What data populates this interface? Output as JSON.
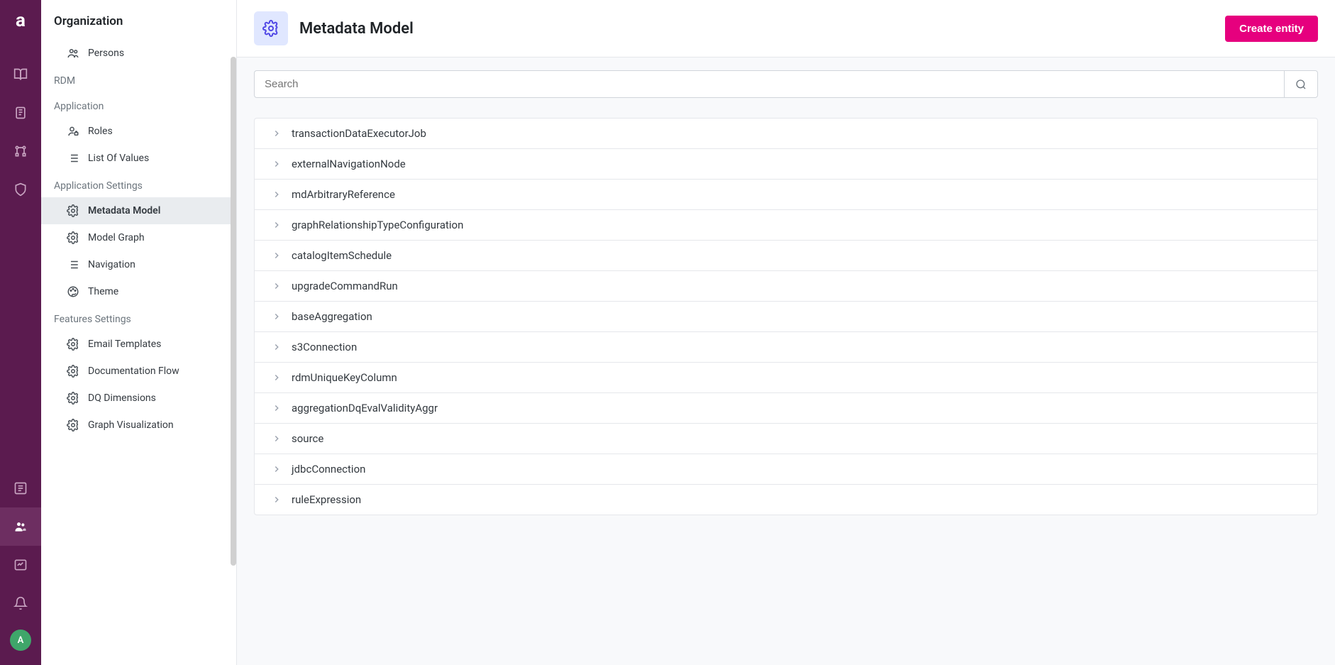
{
  "rail": {
    "logo": "a",
    "avatar": "A"
  },
  "sidebar": {
    "title": "Organization",
    "groups": [
      {
        "label": null,
        "items": [
          {
            "icon": "users",
            "label": "Persons",
            "active": false
          }
        ]
      },
      {
        "label": "RDM",
        "items": []
      },
      {
        "label": "Application",
        "items": [
          {
            "icon": "user-lock",
            "label": "Roles",
            "active": false
          },
          {
            "icon": "list",
            "label": "List Of Values",
            "active": false
          }
        ]
      },
      {
        "label": "Application Settings",
        "items": [
          {
            "icon": "gear",
            "label": "Metadata Model",
            "active": true
          },
          {
            "icon": "gear",
            "label": "Model Graph",
            "active": false
          },
          {
            "icon": "list",
            "label": "Navigation",
            "active": false
          },
          {
            "icon": "palette",
            "label": "Theme",
            "active": false
          }
        ]
      },
      {
        "label": "Features Settings",
        "items": [
          {
            "icon": "gear",
            "label": "Email Templates",
            "active": false
          },
          {
            "icon": "gear",
            "label": "Documentation Flow",
            "active": false
          },
          {
            "icon": "gear",
            "label": "DQ Dimensions",
            "active": false
          },
          {
            "icon": "gear",
            "label": "Graph Visualization",
            "active": false
          }
        ]
      }
    ]
  },
  "header": {
    "title": "Metadata Model",
    "create_button": "Create entity"
  },
  "search": {
    "placeholder": "Search"
  },
  "entities": [
    "transactionDataExecutorJob",
    "externalNavigationNode",
    "mdArbitraryReference",
    "graphRelationshipTypeConfiguration",
    "catalogItemSchedule",
    "upgradeCommandRun",
    "baseAggregation",
    "s3Connection",
    "rdmUniqueKeyColumn",
    "aggregationDqEvalValidityAggr",
    "source",
    "jdbcConnection",
    "ruleExpression"
  ]
}
